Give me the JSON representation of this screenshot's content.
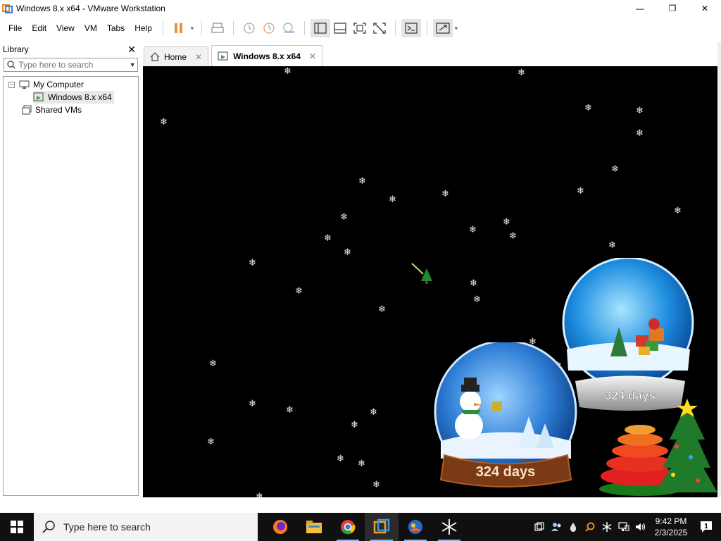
{
  "window": {
    "title": "Windows 8.x x64 - VMware Workstation",
    "minimize_glyph": "—",
    "maximize_glyph": "❐",
    "close_glyph": "✕"
  },
  "menu": {
    "file": "File",
    "edit": "Edit",
    "view": "View",
    "vm": "VM",
    "tabs": "Tabs",
    "help": "Help"
  },
  "toolbar_icons": [
    "pause-icon",
    "send-keys-icon",
    "snapshot-icon",
    "revert-snapshot-icon",
    "snapshot-manager-icon",
    "show-library-icon",
    "thumbnail-bar-icon",
    "full-screen-icon",
    "unity-icon",
    "console-view-icon",
    "stretch-icon"
  ],
  "library": {
    "title": "Library",
    "close_glyph": "✕",
    "search_placeholder": "Type here to search",
    "tree": {
      "my_computer": "My Computer",
      "vm_name": "Windows 8.x x64",
      "shared_vms": "Shared VMs",
      "toggle_glyph": "−"
    }
  },
  "tabs": {
    "home": "Home",
    "vm": "Windows 8.x x64",
    "close_glyph": "✕"
  },
  "vm_screen": {
    "globe_left_text": "324 days",
    "globe_right_text": "324 days",
    "snowflake_glyph": "❄"
  },
  "taskbar": {
    "search_placeholder": "Type here to search",
    "apps": [
      "firefox-icon",
      "file-explorer-icon",
      "chrome-icon",
      "vmware-icon",
      "app-icon",
      "snowflake-app-icon"
    ],
    "time": "9:42 PM",
    "date": "2/3/2025",
    "notification_count": "1"
  },
  "colors": {
    "vm_background": "#000000",
    "taskbar": "#101010",
    "accent_orange": "#e08a1e",
    "accent_blue": "#3a7bc8"
  }
}
